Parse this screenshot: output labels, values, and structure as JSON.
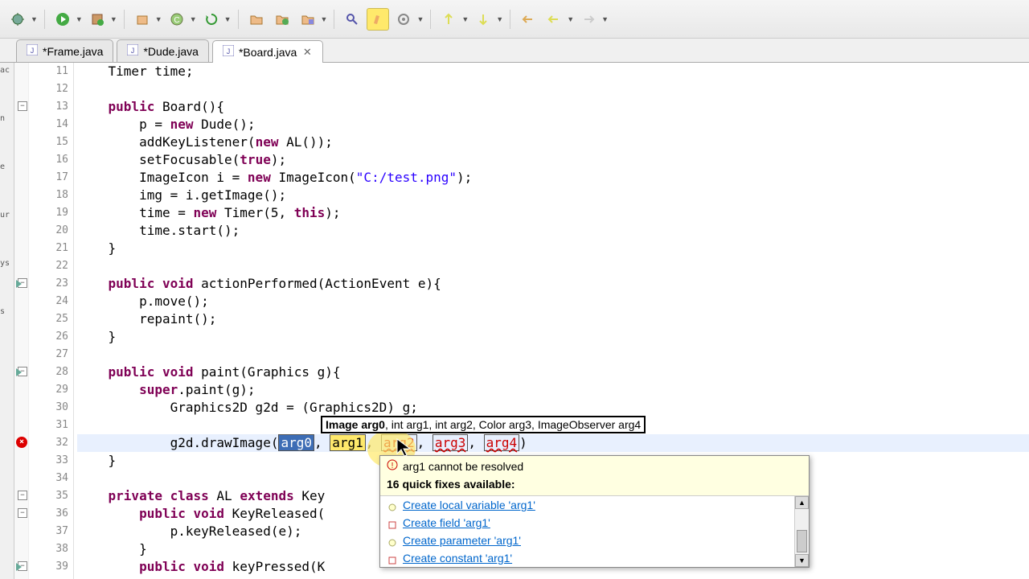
{
  "tabs": [
    {
      "label": "*Frame.java",
      "active": false
    },
    {
      "label": "*Dude.java",
      "active": false
    },
    {
      "label": "*Board.java",
      "active": true
    }
  ],
  "sidebar_fragments": [
    "ac",
    "n",
    "e",
    "ur",
    "ys",
    "s"
  ],
  "lines": [
    {
      "n": 11,
      "indent": 1,
      "raw": "Timer time;"
    },
    {
      "n": 12,
      "indent": 1,
      "raw": ""
    },
    {
      "n": 13,
      "indent": 1,
      "fold": "-",
      "tokens": [
        {
          "t": "public",
          "c": "kw"
        },
        {
          "t": " Board(){"
        }
      ]
    },
    {
      "n": 14,
      "indent": 2,
      "tokens": [
        {
          "t": "p = "
        },
        {
          "t": "new",
          "c": "kw"
        },
        {
          "t": " Dude();"
        }
      ]
    },
    {
      "n": 15,
      "indent": 2,
      "tokens": [
        {
          "t": "addKeyListener("
        },
        {
          "t": "new",
          "c": "kw"
        },
        {
          "t": " AL());"
        }
      ]
    },
    {
      "n": 16,
      "indent": 2,
      "tokens": [
        {
          "t": "setFocusable("
        },
        {
          "t": "true",
          "c": "kw"
        },
        {
          "t": ");"
        }
      ]
    },
    {
      "n": 17,
      "indent": 2,
      "tokens": [
        {
          "t": "ImageIcon i = "
        },
        {
          "t": "new",
          "c": "kw"
        },
        {
          "t": " ImageIcon("
        },
        {
          "t": "\"C:/test.png\"",
          "c": "str"
        },
        {
          "t": ");"
        }
      ]
    },
    {
      "n": 18,
      "indent": 2,
      "tokens": [
        {
          "t": "img = i.getImage();"
        }
      ]
    },
    {
      "n": 19,
      "indent": 2,
      "tokens": [
        {
          "t": "time = "
        },
        {
          "t": "new",
          "c": "kw"
        },
        {
          "t": " Timer(5, "
        },
        {
          "t": "this",
          "c": "kw"
        },
        {
          "t": ");"
        }
      ]
    },
    {
      "n": 20,
      "indent": 2,
      "tokens": [
        {
          "t": "time.start();"
        }
      ]
    },
    {
      "n": 21,
      "indent": 1,
      "raw": "}"
    },
    {
      "n": 22,
      "indent": 1,
      "raw": ""
    },
    {
      "n": 23,
      "indent": 1,
      "fold": "-",
      "arrow": true,
      "tokens": [
        {
          "t": "public",
          "c": "kw"
        },
        {
          "t": " "
        },
        {
          "t": "void",
          "c": "kw"
        },
        {
          "t": " actionPerformed(ActionEvent e){"
        }
      ]
    },
    {
      "n": 24,
      "indent": 2,
      "tokens": [
        {
          "t": "p.move();"
        }
      ]
    },
    {
      "n": 25,
      "indent": 2,
      "tokens": [
        {
          "t": "repaint();"
        }
      ]
    },
    {
      "n": 26,
      "indent": 1,
      "raw": "}"
    },
    {
      "n": 27,
      "indent": 1,
      "raw": ""
    },
    {
      "n": 28,
      "indent": 1,
      "fold": "-",
      "arrow": true,
      "tokens": [
        {
          "t": "public",
          "c": "kw"
        },
        {
          "t": " "
        },
        {
          "t": "void",
          "c": "kw"
        },
        {
          "t": " paint(Graphics g){"
        }
      ]
    },
    {
      "n": 29,
      "indent": 2,
      "tokens": [
        {
          "t": "super",
          "c": "kw"
        },
        {
          "t": ".paint(g);"
        }
      ]
    },
    {
      "n": 30,
      "indent": 3,
      "tokens": [
        {
          "t": "Graphics2D g2d = (Graphics2D) g;"
        }
      ]
    },
    {
      "n": 31,
      "indent": 3,
      "raw": ""
    },
    {
      "n": 32,
      "indent": 3,
      "err": true,
      "hl": true,
      "drawimage": true
    },
    {
      "n": 33,
      "indent": 1,
      "raw": "}"
    },
    {
      "n": 34,
      "indent": 1,
      "raw": ""
    },
    {
      "n": 35,
      "indent": 1,
      "fold": "-",
      "tokens": [
        {
          "t": "private",
          "c": "kw"
        },
        {
          "t": " "
        },
        {
          "t": "class",
          "c": "kw"
        },
        {
          "t": " AL "
        },
        {
          "t": "extends",
          "c": "kw"
        },
        {
          "t": " Key"
        }
      ]
    },
    {
      "n": 36,
      "indent": 2,
      "fold": "-",
      "tokens": [
        {
          "t": "public",
          "c": "kw"
        },
        {
          "t": " "
        },
        {
          "t": "void",
          "c": "kw"
        },
        {
          "t": " KeyReleased("
        }
      ]
    },
    {
      "n": 37,
      "indent": 3,
      "tokens": [
        {
          "t": "p.keyReleased(e);"
        }
      ]
    },
    {
      "n": 38,
      "indent": 2,
      "raw": "}"
    },
    {
      "n": 39,
      "indent": 2,
      "fold": "-",
      "arrow": true,
      "tokens": [
        {
          "t": "public",
          "c": "kw"
        },
        {
          "t": " "
        },
        {
          "t": "void",
          "c": "kw"
        },
        {
          "t": " keyPressed(K"
        }
      ]
    }
  ],
  "drawimage": {
    "prefix": "g2d.drawImage(",
    "args": [
      "arg0",
      "arg1",
      "arg2",
      "arg3",
      "arg4"
    ],
    "suffix": ")"
  },
  "param_hint": {
    "bold": "Image arg0",
    "rest": ", int arg1, int arg2, Color arg3, ImageObserver arg4"
  },
  "quickfix": {
    "error": "arg1 cannot be resolved",
    "subheader": "16 quick fixes available:",
    "items": [
      {
        "icon": "bulb",
        "label": "Create local variable 'arg1'"
      },
      {
        "icon": "red",
        "label": "Create field 'arg1'"
      },
      {
        "icon": "bulb",
        "label": "Create parameter 'arg1'"
      },
      {
        "icon": "red",
        "label": "Create constant 'arg1'"
      }
    ]
  }
}
